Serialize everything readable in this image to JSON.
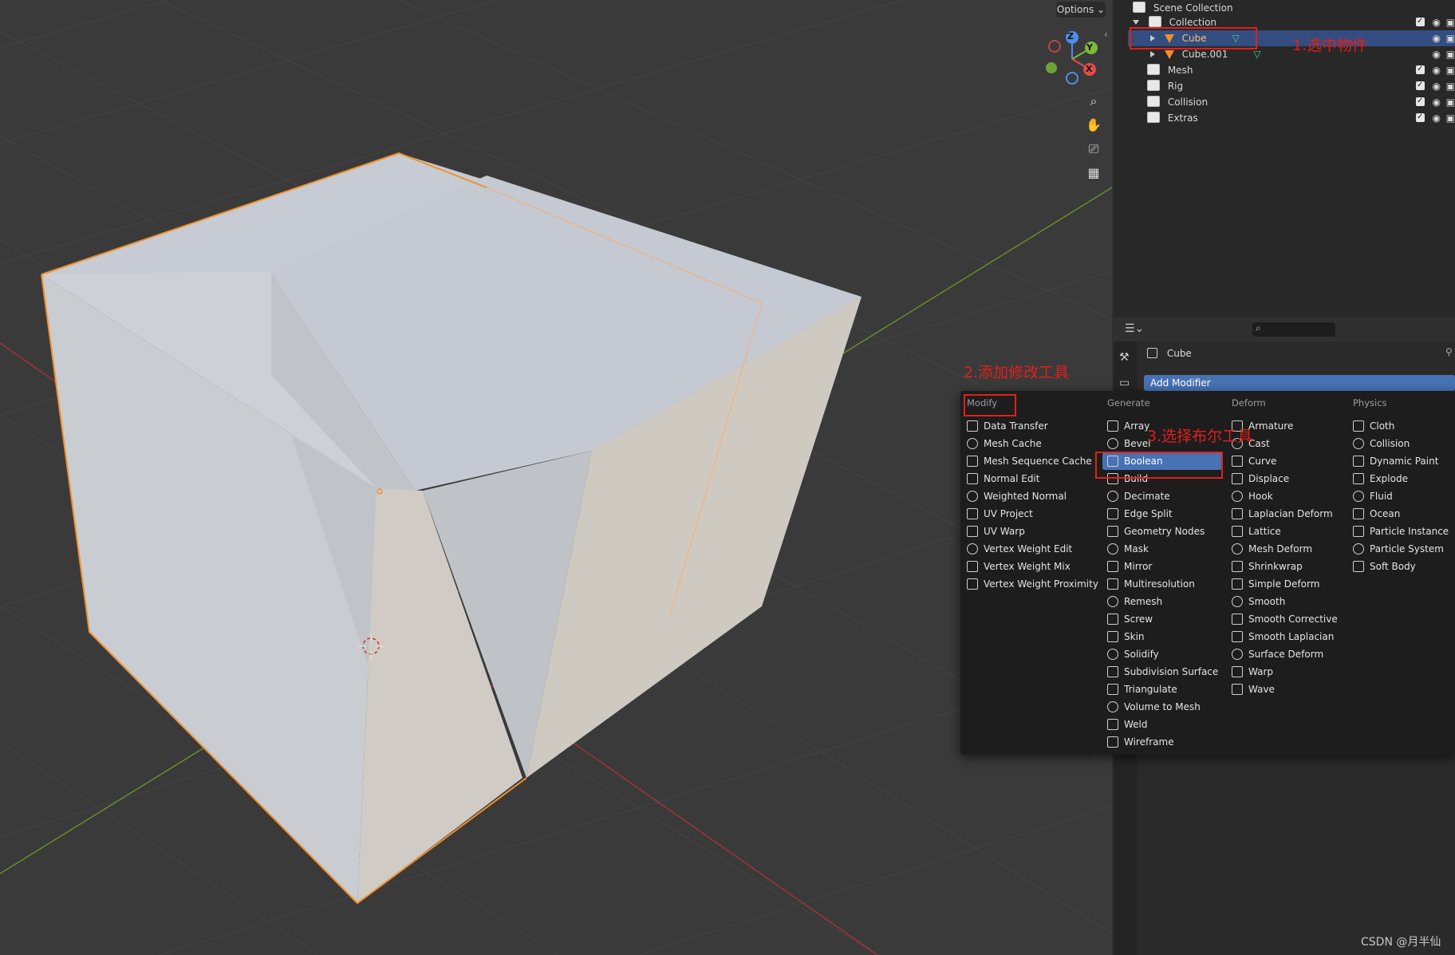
{
  "viewport": {
    "options_label": "Options"
  },
  "gizmo": {
    "z_label": "Z",
    "y_label": "Y",
    "x_label": "X"
  },
  "outliner": {
    "scene_collection": "Scene Collection",
    "rows": [
      {
        "label": "Collection",
        "kind": "collection",
        "level": 1,
        "expanded": true
      },
      {
        "label": "Cube",
        "kind": "mesh",
        "level": 2,
        "selected": true
      },
      {
        "label": "Cube.001",
        "kind": "mesh",
        "level": 2
      },
      {
        "label": "Mesh",
        "kind": "collection",
        "level": 1
      },
      {
        "label": "Rig",
        "kind": "collection",
        "level": 1
      },
      {
        "label": "Collision",
        "kind": "collection",
        "level": 1
      },
      {
        "label": "Extras",
        "kind": "collection",
        "level": 1
      }
    ]
  },
  "properties": {
    "object_name": "Cube",
    "add_modifier_label": "Add Modifier"
  },
  "menu": {
    "columns": [
      {
        "header": "Modify",
        "items": [
          "Data Transfer",
          "Mesh Cache",
          "Mesh Sequence Cache",
          "Normal Edit",
          "Weighted Normal",
          "UV Project",
          "UV Warp",
          "Vertex Weight Edit",
          "Vertex Weight Mix",
          "Vertex Weight Proximity"
        ]
      },
      {
        "header": "Generate",
        "items": [
          "Array",
          "Bevel",
          "Boolean",
          "Build",
          "Decimate",
          "Edge Split",
          "Geometry Nodes",
          "Mask",
          "Mirror",
          "Multiresolution",
          "Remesh",
          "Screw",
          "Skin",
          "Solidify",
          "Subdivision Surface",
          "Triangulate",
          "Volume to Mesh",
          "Weld",
          "Wireframe"
        ]
      },
      {
        "header": "Deform",
        "items": [
          "Armature",
          "Cast",
          "Curve",
          "Displace",
          "Hook",
          "Laplacian Deform",
          "Lattice",
          "Mesh Deform",
          "Shrinkwrap",
          "Simple Deform",
          "Smooth",
          "Smooth Corrective",
          "Smooth Laplacian",
          "Surface Deform",
          "Warp",
          "Wave"
        ]
      },
      {
        "header": "Physics",
        "items": [
          "Cloth",
          "Collision",
          "Dynamic Paint",
          "Explode",
          "Fluid",
          "Ocean",
          "Particle Instance",
          "Particle System",
          "Soft Body"
        ]
      }
    ],
    "highlighted": "Boolean"
  },
  "annotations": {
    "step1": "1.选中物件",
    "step2": "2.添加修改工具",
    "step3": "3.选择布尔工具"
  },
  "watermark": "CSDN @月半仙",
  "colors": {
    "selection": "#334d80",
    "highlight": "#4772b3",
    "annotation": "#e0201a",
    "object_outline": "#f0902e"
  }
}
